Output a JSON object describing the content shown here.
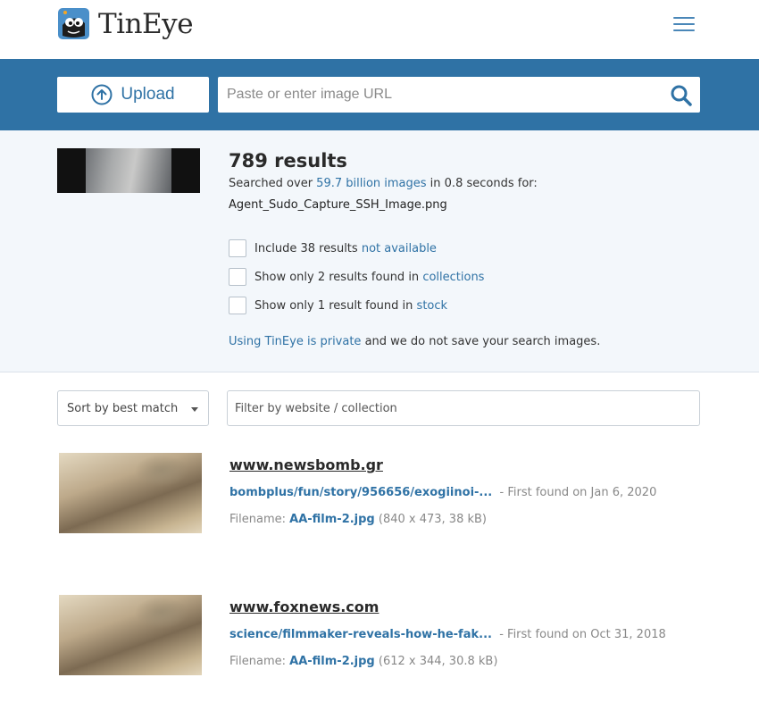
{
  "header": {
    "brand": "TinEye",
    "logo_icon": "tineye-mascot-icon",
    "menu_icon": "hamburger-menu-icon"
  },
  "search": {
    "upload_label": "Upload",
    "url_placeholder": "Paste or enter image URL",
    "search_icon": "magnifier-icon"
  },
  "summary": {
    "count": "789 results",
    "searched_prefix": "Searched over ",
    "searched_link": "59.7 billion images",
    "searched_suffix": " in 0.8 seconds for:",
    "query_filename": "Agent_Sudo_Capture_SSH_Image.png",
    "options": [
      {
        "prefix": "Include 38 results ",
        "link": "not available"
      },
      {
        "prefix": "Show only 2 results found in ",
        "link": "collections"
      },
      {
        "prefix": "Show only 1 result found in ",
        "link": "stock"
      }
    ],
    "private_link": "Using TinEye is private",
    "private_suffix": " and we do not save your search images."
  },
  "filters": {
    "sort_label": "Sort by best match",
    "filter_placeholder": "Filter by website / collection"
  },
  "results": [
    {
      "site": "www.newsbomb.gr",
      "path": "bombplus/fun/story/956656/exogiinoi-...",
      "first_found": "- First found on Jan 6, 2020",
      "filename_label": "Filename: ",
      "filename": "AA-film-2.jpg",
      "file_meta": " (840 x 473, 38 kB)"
    },
    {
      "site": "www.foxnews.com",
      "path": "science/filmmaker-reveals-how-he-fak...",
      "first_found": "- First found on Oct 31, 2018",
      "filename_label": "Filename: ",
      "filename": "AA-film-2.jpg",
      "file_meta": " (612 x 344, 30.8 kB)"
    }
  ],
  "colors": {
    "brand_blue": "#2f72a5",
    "summary_bg": "#f3f7fb"
  }
}
